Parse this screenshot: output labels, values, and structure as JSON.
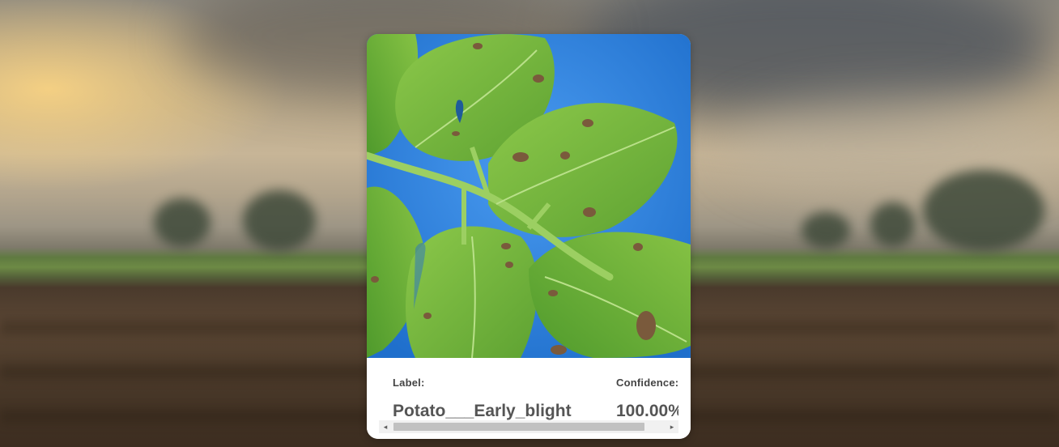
{
  "background": {
    "scene": "blurred-farm-field"
  },
  "card": {
    "image_alt": "potato-leaf-with-early-blight",
    "label_heading": "Label:",
    "label_value": "Potato___Early_blight",
    "confidence_heading": "Confidence:",
    "confidence_value": "100.00%"
  },
  "scrollbar": {
    "left_arrow": "◂",
    "right_arrow": "▸"
  },
  "colors": {
    "card_bg": "#ffffff",
    "image_bg": "#2f86dd",
    "leaf": "#6fb43a",
    "lesion": "#7a5a3c"
  }
}
